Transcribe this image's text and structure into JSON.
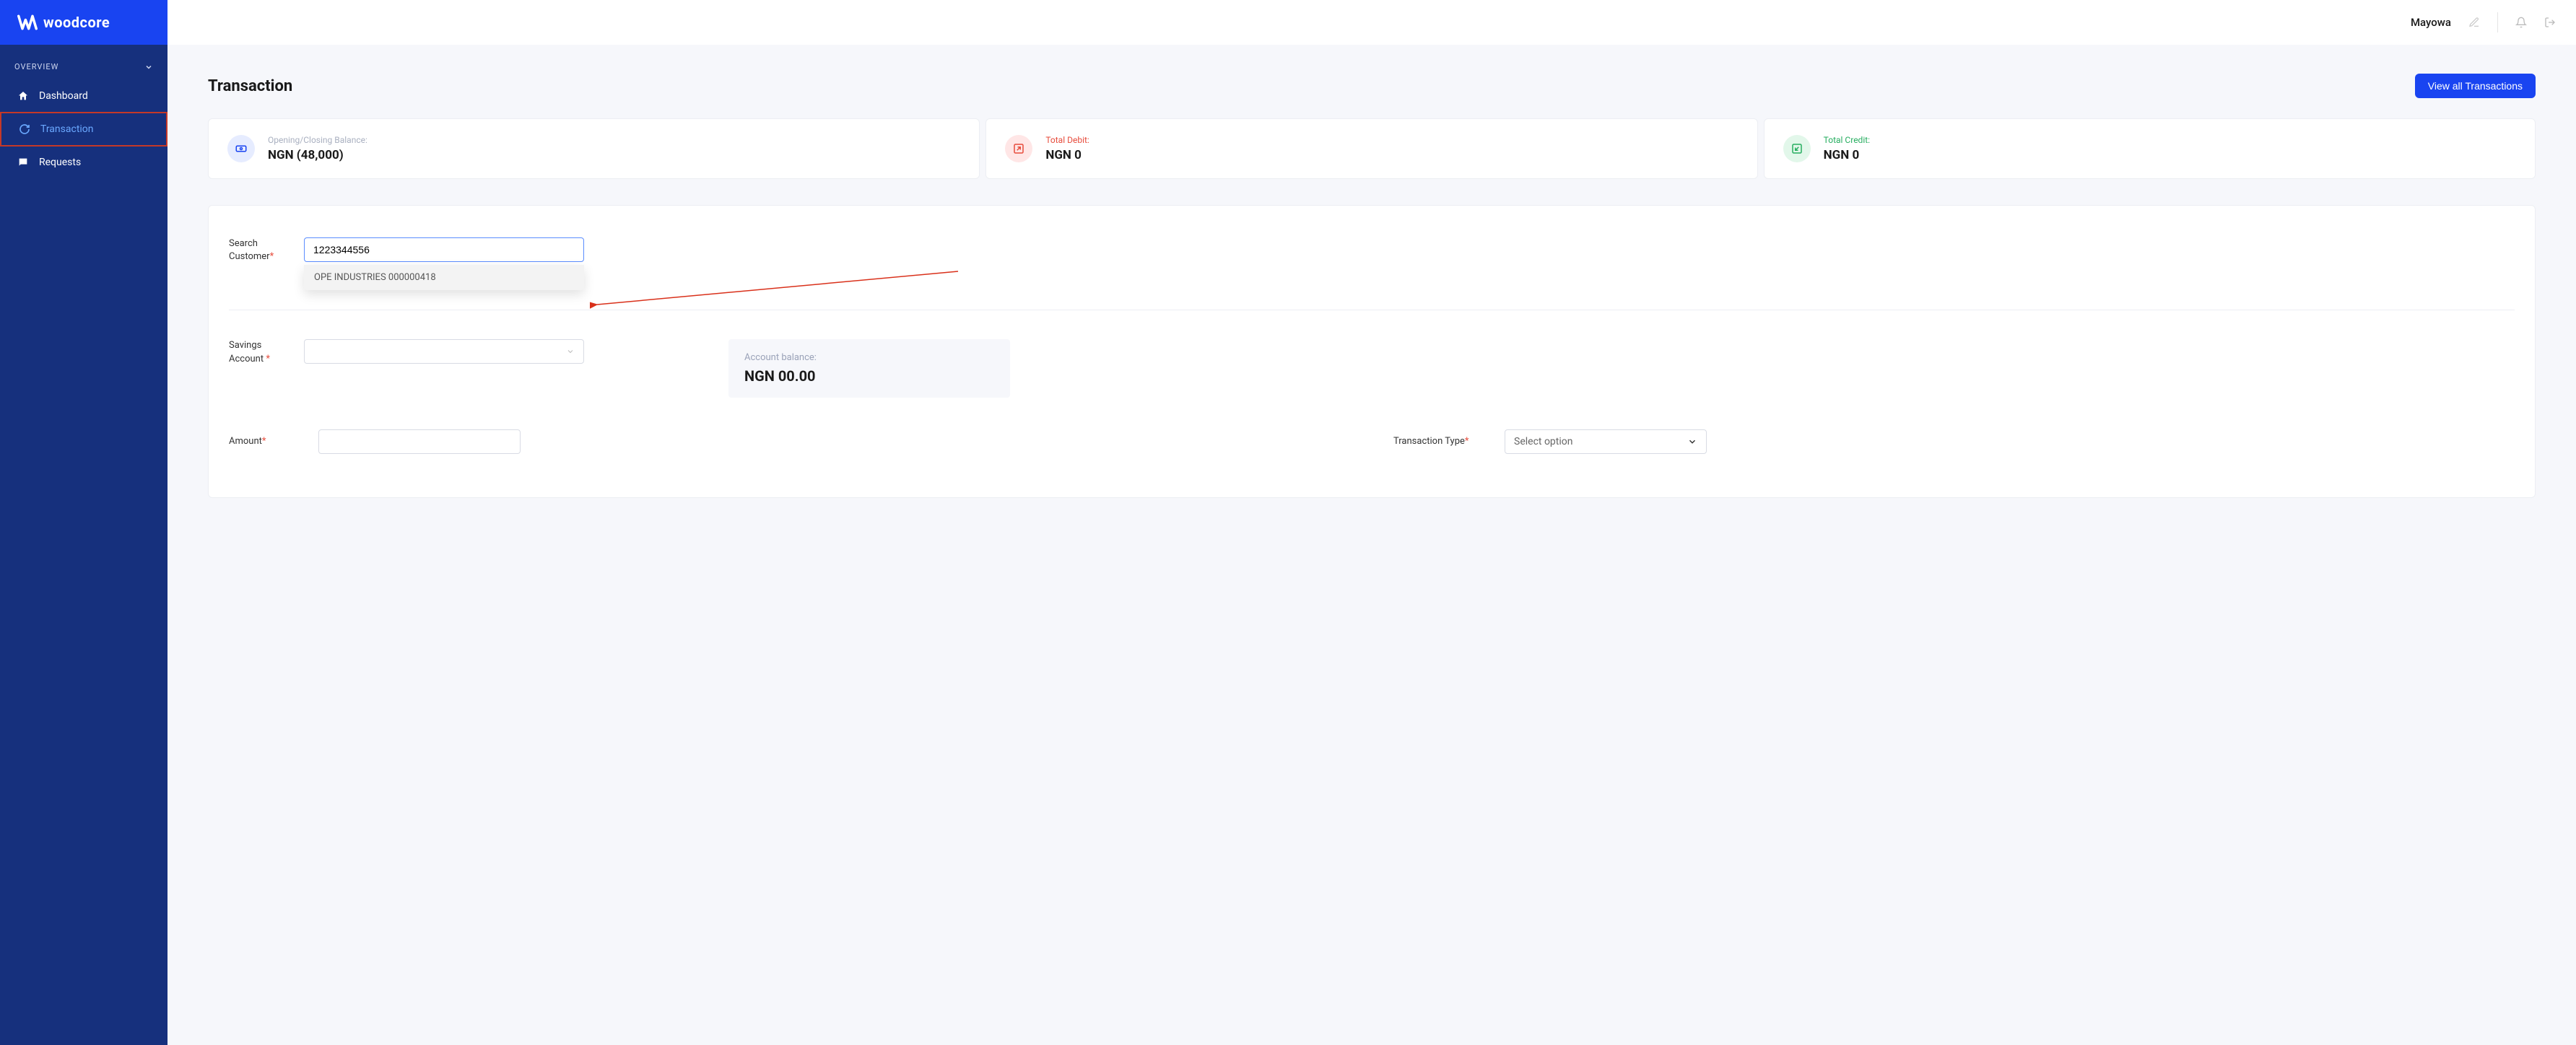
{
  "brand": {
    "name": "woodcore"
  },
  "sidebar": {
    "section": "OVERVIEW",
    "items": [
      {
        "label": "Dashboard"
      },
      {
        "label": "Transaction"
      },
      {
        "label": "Requests"
      }
    ]
  },
  "topbar": {
    "user_name": "Mayowa"
  },
  "page": {
    "title": "Transaction",
    "view_all": "View all Transactions"
  },
  "stats": {
    "balance": {
      "label": "Opening/Closing Balance:",
      "value": "NGN (48,000)"
    },
    "debit": {
      "label": "Total Debit:",
      "value": "NGN 0"
    },
    "credit": {
      "label": "Total Credit:",
      "value": "NGN 0"
    }
  },
  "form": {
    "search_label": "Search Customer",
    "search_value": "1223344556",
    "dropdown_option": "OPE INDUSTRIES 000000418",
    "savings_label": "Savings Account",
    "balance_label": "Account balance:",
    "balance_value": "NGN 00.00",
    "amount_label": "Amount",
    "txn_type_label": "Transaction Type",
    "select_placeholder": "Select option"
  }
}
